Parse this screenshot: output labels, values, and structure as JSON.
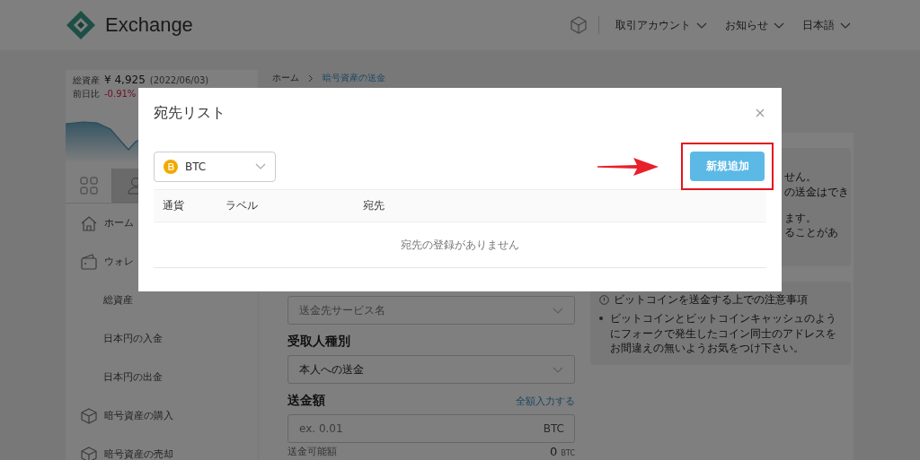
{
  "header": {
    "logo_text": "Exchange",
    "menus": [
      {
        "label": "取引アカウント"
      },
      {
        "label": "お知らせ"
      },
      {
        "label": "日本語"
      }
    ]
  },
  "sidebar": {
    "total_label": "総資産",
    "total_value": "¥ 4,925",
    "total_date": "(2022/06/03)",
    "change_label": "前日比",
    "change_value": "-0.91%",
    "tabs": [
      {
        "kind": "grid",
        "selected": true
      },
      {
        "kind": "person",
        "selected": false
      }
    ],
    "nav": [
      {
        "kind": "home",
        "label": "ホーム"
      },
      {
        "kind": "wallet",
        "label": "ウォレ"
      },
      {
        "kind": "sub",
        "label": "総資産"
      },
      {
        "kind": "sub",
        "label": "日本円の入金"
      },
      {
        "kind": "sub",
        "label": "日本円の出金"
      },
      {
        "kind": "box",
        "label": "暗号資産の購入"
      },
      {
        "kind": "box",
        "label": "暗号資産の売却"
      }
    ]
  },
  "breadcrumb": [
    {
      "label": "ホーム",
      "current": false
    },
    {
      "label": "暗号資産の送金",
      "current": true
    }
  ],
  "form": {
    "service_select": {
      "placeholder": "送金先サービス名"
    },
    "recipient": {
      "label": "受取人種別",
      "value": "本人への送金"
    },
    "amount": {
      "label": "送金額",
      "link": "全額入力する",
      "placeholder": "ex. 0.01",
      "unit": "BTC"
    },
    "available": {
      "label": "送金可能額",
      "value": "0",
      "unit": "BTC"
    }
  },
  "notices": [
    {
      "lines": [
        "せん。",
        "の送金はでき",
        "ます。",
        "ることがあ"
      ]
    },
    {
      "title": "ビットコインを送金する上での注意事項",
      "bullets": [
        "ビットコインとビットコインキャッシュのようにフォークで発生したコイン同士のアドレスをお間違えの無いようお気をつけ下さい。"
      ]
    }
  ],
  "modal": {
    "title": "宛先リスト",
    "currency_select": {
      "value": "BTC"
    },
    "add_button": "新規追加",
    "columns": [
      "通貨",
      "ラベル",
      "宛先"
    ],
    "empty_message": "宛先の登録がありません"
  }
}
